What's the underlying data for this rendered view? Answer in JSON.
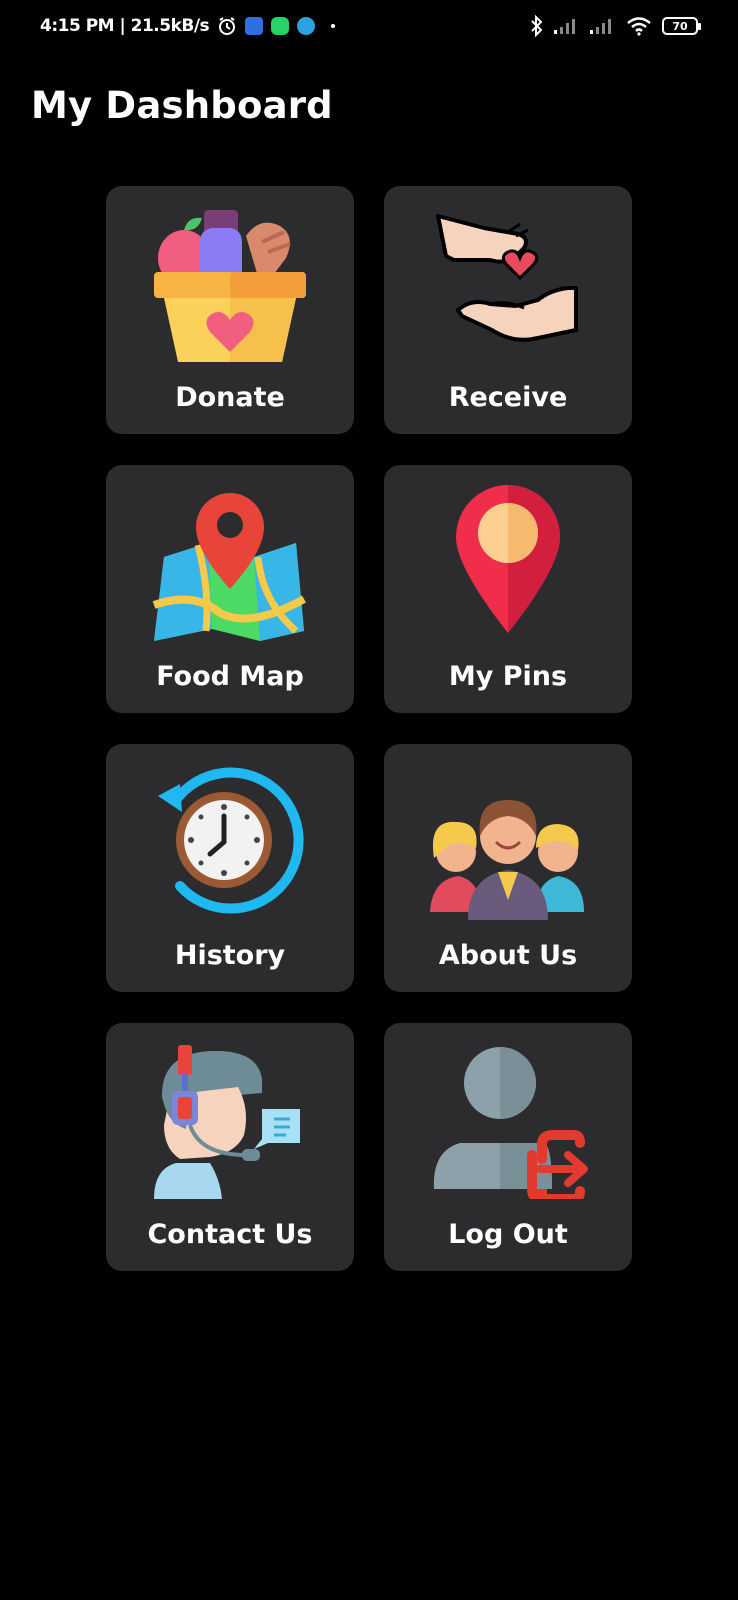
{
  "status_bar": {
    "time_speed": "4:15 PM | 21.5kB/s",
    "battery": "70"
  },
  "page": {
    "title": "My Dashboard"
  },
  "tiles": [
    {
      "label": "Donate",
      "icon": "food-basket-icon"
    },
    {
      "label": "Receive",
      "icon": "hands-heart-icon"
    },
    {
      "label": "Food Map",
      "icon": "map-pin-icon"
    },
    {
      "label": "My Pins",
      "icon": "location-pin-icon"
    },
    {
      "label": "History",
      "icon": "history-clock-icon"
    },
    {
      "label": "About Us",
      "icon": "team-icon"
    },
    {
      "label": "Contact Us",
      "icon": "support-agent-icon"
    },
    {
      "label": "Log Out",
      "icon": "logout-user-icon"
    }
  ],
  "colors": {
    "background": "#000000",
    "tile": "#2c2c2e",
    "text": "#ffffff"
  }
}
